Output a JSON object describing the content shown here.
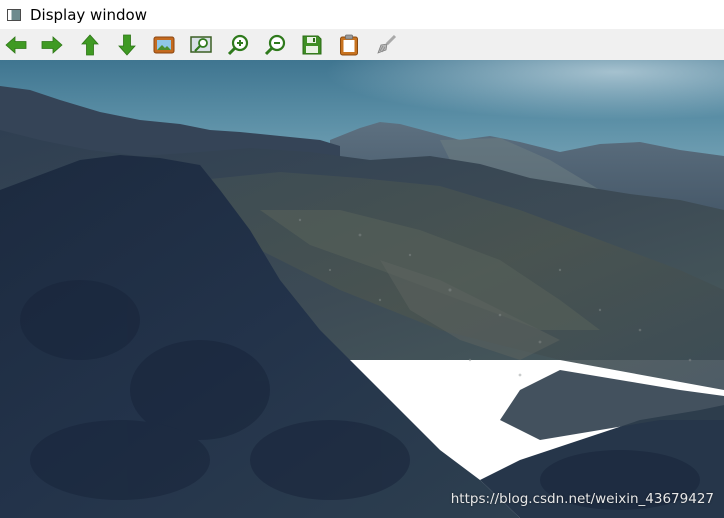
{
  "window": {
    "title": "Display window"
  },
  "toolbar": {
    "buttons": [
      {
        "icon": "arrow-left-icon",
        "name": "pan-left-button"
      },
      {
        "icon": "arrow-right-icon",
        "name": "pan-right-button"
      },
      {
        "icon": "arrow-up-icon",
        "name": "pan-up-button"
      },
      {
        "icon": "arrow-down-icon",
        "name": "pan-down-button"
      },
      {
        "icon": "picture-icon",
        "name": "zoom-fit-button"
      },
      {
        "icon": "zoom-region-icon",
        "name": "zoom-region-button"
      },
      {
        "icon": "zoom-in-icon",
        "name": "zoom-in-button"
      },
      {
        "icon": "zoom-out-icon",
        "name": "zoom-out-button"
      },
      {
        "icon": "save-icon",
        "name": "save-button"
      },
      {
        "icon": "clipboard-icon",
        "name": "copy-button"
      },
      {
        "icon": "brush-icon",
        "name": "properties-button"
      }
    ]
  },
  "image": {
    "watermark": "https://blog.csdn.net/weixin_43679427"
  },
  "colors": {
    "toolbar_bg": "#f0f0f0",
    "arrow_green": "#3f9a23",
    "sky": "#5b8fa6",
    "mountain_dark": "#1f2f45"
  }
}
